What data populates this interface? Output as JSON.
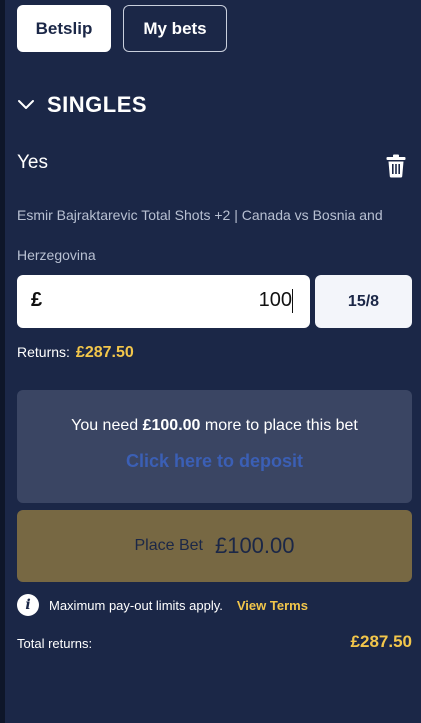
{
  "tabs": {
    "betslip": "Betslip",
    "my_bets": "My bets"
  },
  "section": {
    "title": "SINGLES"
  },
  "bet": {
    "selection": "Yes",
    "market": "Esmir Bajraktarevic Total Shots +2 | Canada vs Bosnia and Herzegovina",
    "currency": "£",
    "stake": "100",
    "odds": "15/8",
    "returns_label": "Returns:",
    "returns_value": "£287.50"
  },
  "deposit": {
    "need_prefix": "You need",
    "need_amount": "£100.00",
    "need_suffix": "more to place this bet",
    "link": "Click here to deposit"
  },
  "place_bet": {
    "label": "Place Bet",
    "amount": "£100.00"
  },
  "info": {
    "text": "Maximum pay-out limits apply.",
    "link": "View Terms"
  },
  "total": {
    "label": "Total returns:",
    "value": "£287.50"
  },
  "colors": {
    "background": "#1b2747",
    "accent_gold": "#f2c64b",
    "deposit_link": "#3b5fb5",
    "place_bet_disabled": "#776843"
  },
  "icons": {
    "chevron": "chevron-down-icon",
    "trash": "trash-icon",
    "info": "info-icon"
  }
}
